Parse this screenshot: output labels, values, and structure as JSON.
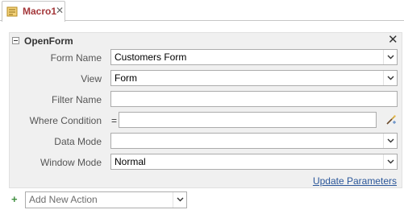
{
  "tab": {
    "label": "Macro1",
    "icon": "macro-icon",
    "close": "✕"
  },
  "action": {
    "name": "OpenForm",
    "collapse_icon": "collapse-minus-icon",
    "delete_icon": "✕",
    "arguments": {
      "form_name": {
        "label": "Form Name",
        "value": "Customers Form"
      },
      "view": {
        "label": "View",
        "value": "Form"
      },
      "filter_name": {
        "label": "Filter Name",
        "value": ""
      },
      "where_condition": {
        "label": "Where Condition",
        "prefix": "=",
        "value": ""
      },
      "data_mode": {
        "label": "Data Mode",
        "value": ""
      },
      "window_mode": {
        "label": "Window Mode",
        "value": "Normal"
      }
    },
    "update_link": "Update Parameters"
  },
  "add_action": {
    "icon": "+",
    "placeholder": "Add New Action"
  },
  "colors": {
    "tab_label": "#a4373a",
    "link": "#2b579a",
    "block_bg": "#f0f0f0",
    "add_icon": "#3f8f3f"
  }
}
